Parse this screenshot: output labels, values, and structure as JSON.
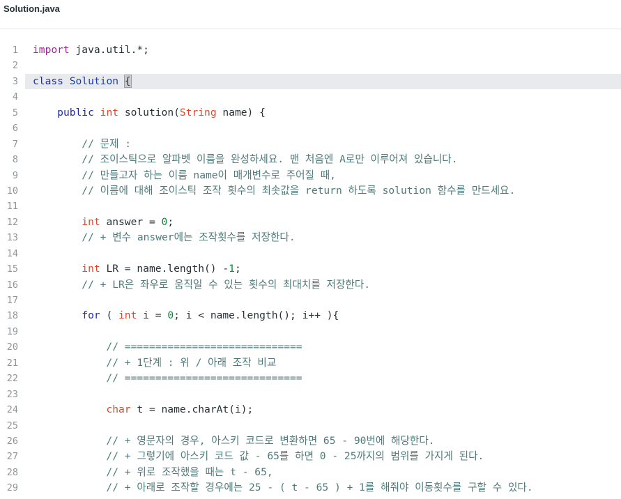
{
  "tab": {
    "filename": "Solution.java"
  },
  "lines": [
    {
      "n": "1",
      "segs": [
        [
          "kw2",
          "import"
        ],
        [
          "plain",
          " java.util.*;"
        ]
      ]
    },
    {
      "n": "2",
      "segs": []
    },
    {
      "n": "3",
      "active": true,
      "segs": [
        [
          "kw",
          "class"
        ],
        [
          "plain",
          " "
        ],
        [
          "cls",
          "Solution"
        ],
        [
          "plain",
          " "
        ],
        [
          "brace",
          "{"
        ],
        [
          "cursor",
          ""
        ]
      ]
    },
    {
      "n": "4",
      "segs": []
    },
    {
      "n": "5",
      "segs": [
        [
          "plain",
          "    "
        ],
        [
          "kw",
          "public"
        ],
        [
          "plain",
          " "
        ],
        [
          "ty",
          "int"
        ],
        [
          "plain",
          " solution("
        ],
        [
          "ty",
          "String"
        ],
        [
          "plain",
          " name) {"
        ]
      ]
    },
    {
      "n": "6",
      "segs": []
    },
    {
      "n": "7",
      "segs": [
        [
          "cm",
          "        // 문제 :"
        ]
      ]
    },
    {
      "n": "8",
      "segs": [
        [
          "cm",
          "        // 조이스틱으로 알파벳 이름을 완성하세요. 맨 처음엔 A로만 이루어져 있습니다."
        ]
      ]
    },
    {
      "n": "9",
      "segs": [
        [
          "cm",
          "        // 만들고자 하는 이름 name이 매개변수로 주어질 때,"
        ]
      ]
    },
    {
      "n": "10",
      "segs": [
        [
          "cm",
          "        // 이름에 대해 조이스틱 조작 횟수의 최솟값을 return 하도록 solution 함수를 만드세요."
        ]
      ]
    },
    {
      "n": "11",
      "segs": []
    },
    {
      "n": "12",
      "segs": [
        [
          "plain",
          "        "
        ],
        [
          "ty",
          "int"
        ],
        [
          "plain",
          " answer = "
        ],
        [
          "num",
          "0"
        ],
        [
          "plain",
          ";"
        ]
      ]
    },
    {
      "n": "13",
      "segs": [
        [
          "cm",
          "        // + 변수 answer에는 조작횟수를 저장한다."
        ]
      ]
    },
    {
      "n": "14",
      "segs": []
    },
    {
      "n": "15",
      "segs": [
        [
          "plain",
          "        "
        ],
        [
          "ty",
          "int"
        ],
        [
          "plain",
          " LR = name.length() -"
        ],
        [
          "num",
          "1"
        ],
        [
          "plain",
          ";"
        ]
      ]
    },
    {
      "n": "16",
      "segs": [
        [
          "cm",
          "        // + LR은 좌우로 움직일 수 있는 횟수의 최대치를 저장한다."
        ]
      ]
    },
    {
      "n": "17",
      "segs": []
    },
    {
      "n": "18",
      "segs": [
        [
          "plain",
          "        "
        ],
        [
          "kw",
          "for"
        ],
        [
          "plain",
          " ( "
        ],
        [
          "ty",
          "int"
        ],
        [
          "plain",
          " i = "
        ],
        [
          "num",
          "0"
        ],
        [
          "plain",
          "; i < name.length(); i++ ){"
        ]
      ]
    },
    {
      "n": "19",
      "segs": []
    },
    {
      "n": "20",
      "segs": [
        [
          "cm",
          "            // ============================="
        ]
      ]
    },
    {
      "n": "21",
      "segs": [
        [
          "cm",
          "            // + 1단계 : 위 / 아래 조작 비교"
        ]
      ]
    },
    {
      "n": "22",
      "segs": [
        [
          "cm",
          "            // ============================="
        ]
      ]
    },
    {
      "n": "23",
      "segs": []
    },
    {
      "n": "24",
      "segs": [
        [
          "plain",
          "            "
        ],
        [
          "ty",
          "char"
        ],
        [
          "plain",
          " t = name.charAt(i);"
        ]
      ]
    },
    {
      "n": "25",
      "segs": []
    },
    {
      "n": "26",
      "segs": [
        [
          "cm",
          "            // + 영문자의 경우, 아스키 코드로 변환하면 65 - 90번에 해당한다."
        ]
      ]
    },
    {
      "n": "27",
      "segs": [
        [
          "cm",
          "            // + 그렇기에 아스키 코드 값 - 65를 하면 0 - 25까지의 범위를 가지게 된다."
        ]
      ]
    },
    {
      "n": "28",
      "segs": [
        [
          "cm",
          "            // + 위로 조작했을 때는 t - 65,"
        ]
      ]
    },
    {
      "n": "29",
      "segs": [
        [
          "cm",
          "            // + 아래로 조작할 경우에는 25 - ( t - 65 ) + 1를 해줘야 이동횟수를 구할 수 있다."
        ]
      ]
    }
  ]
}
